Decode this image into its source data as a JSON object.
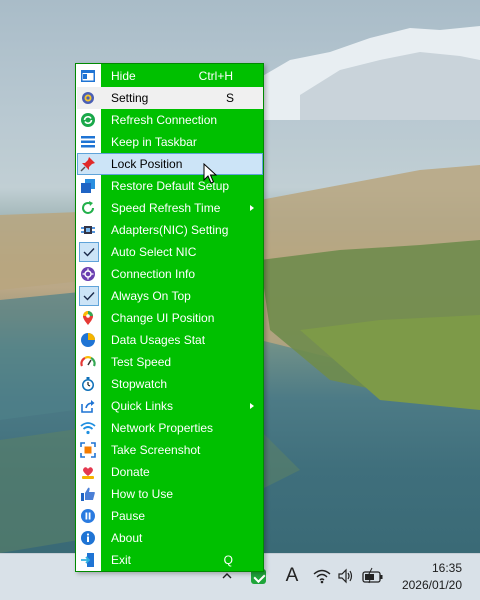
{
  "menu": {
    "items": [
      {
        "label": "Hide",
        "shortcut": "Ctrl+H",
        "icon": "window-icon",
        "state": "normal"
      },
      {
        "label": "Setting",
        "shortcut": "S",
        "icon": "gear-icon",
        "state": "highlight-white"
      },
      {
        "label": "Refresh Connection",
        "icon": "refresh-icon",
        "state": "normal"
      },
      {
        "label": "Keep in Taskbar",
        "icon": "taskbar-icon",
        "state": "normal"
      },
      {
        "label": "Lock Position",
        "icon": "pin-icon",
        "state": "hover"
      },
      {
        "label": "Restore Default Setup",
        "icon": "restore-icon",
        "state": "normal"
      },
      {
        "label": "Speed Refresh Time",
        "icon": "timer-refresh-icon",
        "submenu": true
      },
      {
        "label": "Adapters(NIC) Setting",
        "icon": "network-adapter-icon",
        "state": "normal"
      },
      {
        "label": "Auto Select NIC",
        "icon": "check-icon",
        "checked": true
      },
      {
        "label": "Connection Info",
        "icon": "connection-info-icon",
        "state": "normal"
      },
      {
        "label": "Always On Top",
        "icon": "check-icon",
        "checked": true
      },
      {
        "label": "Change UI Position",
        "icon": "location-icon",
        "state": "normal"
      },
      {
        "label": "Data Usages Stat",
        "icon": "pie-chart-icon",
        "state": "normal"
      },
      {
        "label": "Test Speed",
        "icon": "speedometer-icon",
        "state": "normal"
      },
      {
        "label": "Stopwatch",
        "icon": "stopwatch-icon",
        "state": "normal"
      },
      {
        "label": "Quick Links",
        "icon": "share-icon",
        "submenu": true
      },
      {
        "label": "Network Properties",
        "icon": "wifi-icon",
        "state": "normal"
      },
      {
        "label": "Take Screenshot",
        "icon": "screenshot-icon",
        "state": "normal"
      },
      {
        "label": "Donate",
        "icon": "donate-heart-icon",
        "state": "normal"
      },
      {
        "label": "How to Use",
        "icon": "thumbs-up-icon",
        "state": "normal"
      },
      {
        "label": "Pause",
        "icon": "pause-icon",
        "state": "normal"
      },
      {
        "label": "About",
        "icon": "info-icon",
        "state": "normal"
      },
      {
        "label": "Exit",
        "shortcut": "Q",
        "icon": "exit-icon",
        "state": "normal"
      }
    ],
    "colors": {
      "background": "#00c000",
      "hover": "#cce4f7",
      "text": "#ffffff"
    }
  },
  "taskbar": {
    "ime_label": "A",
    "time": "16:35",
    "date": "2026/01/20"
  }
}
